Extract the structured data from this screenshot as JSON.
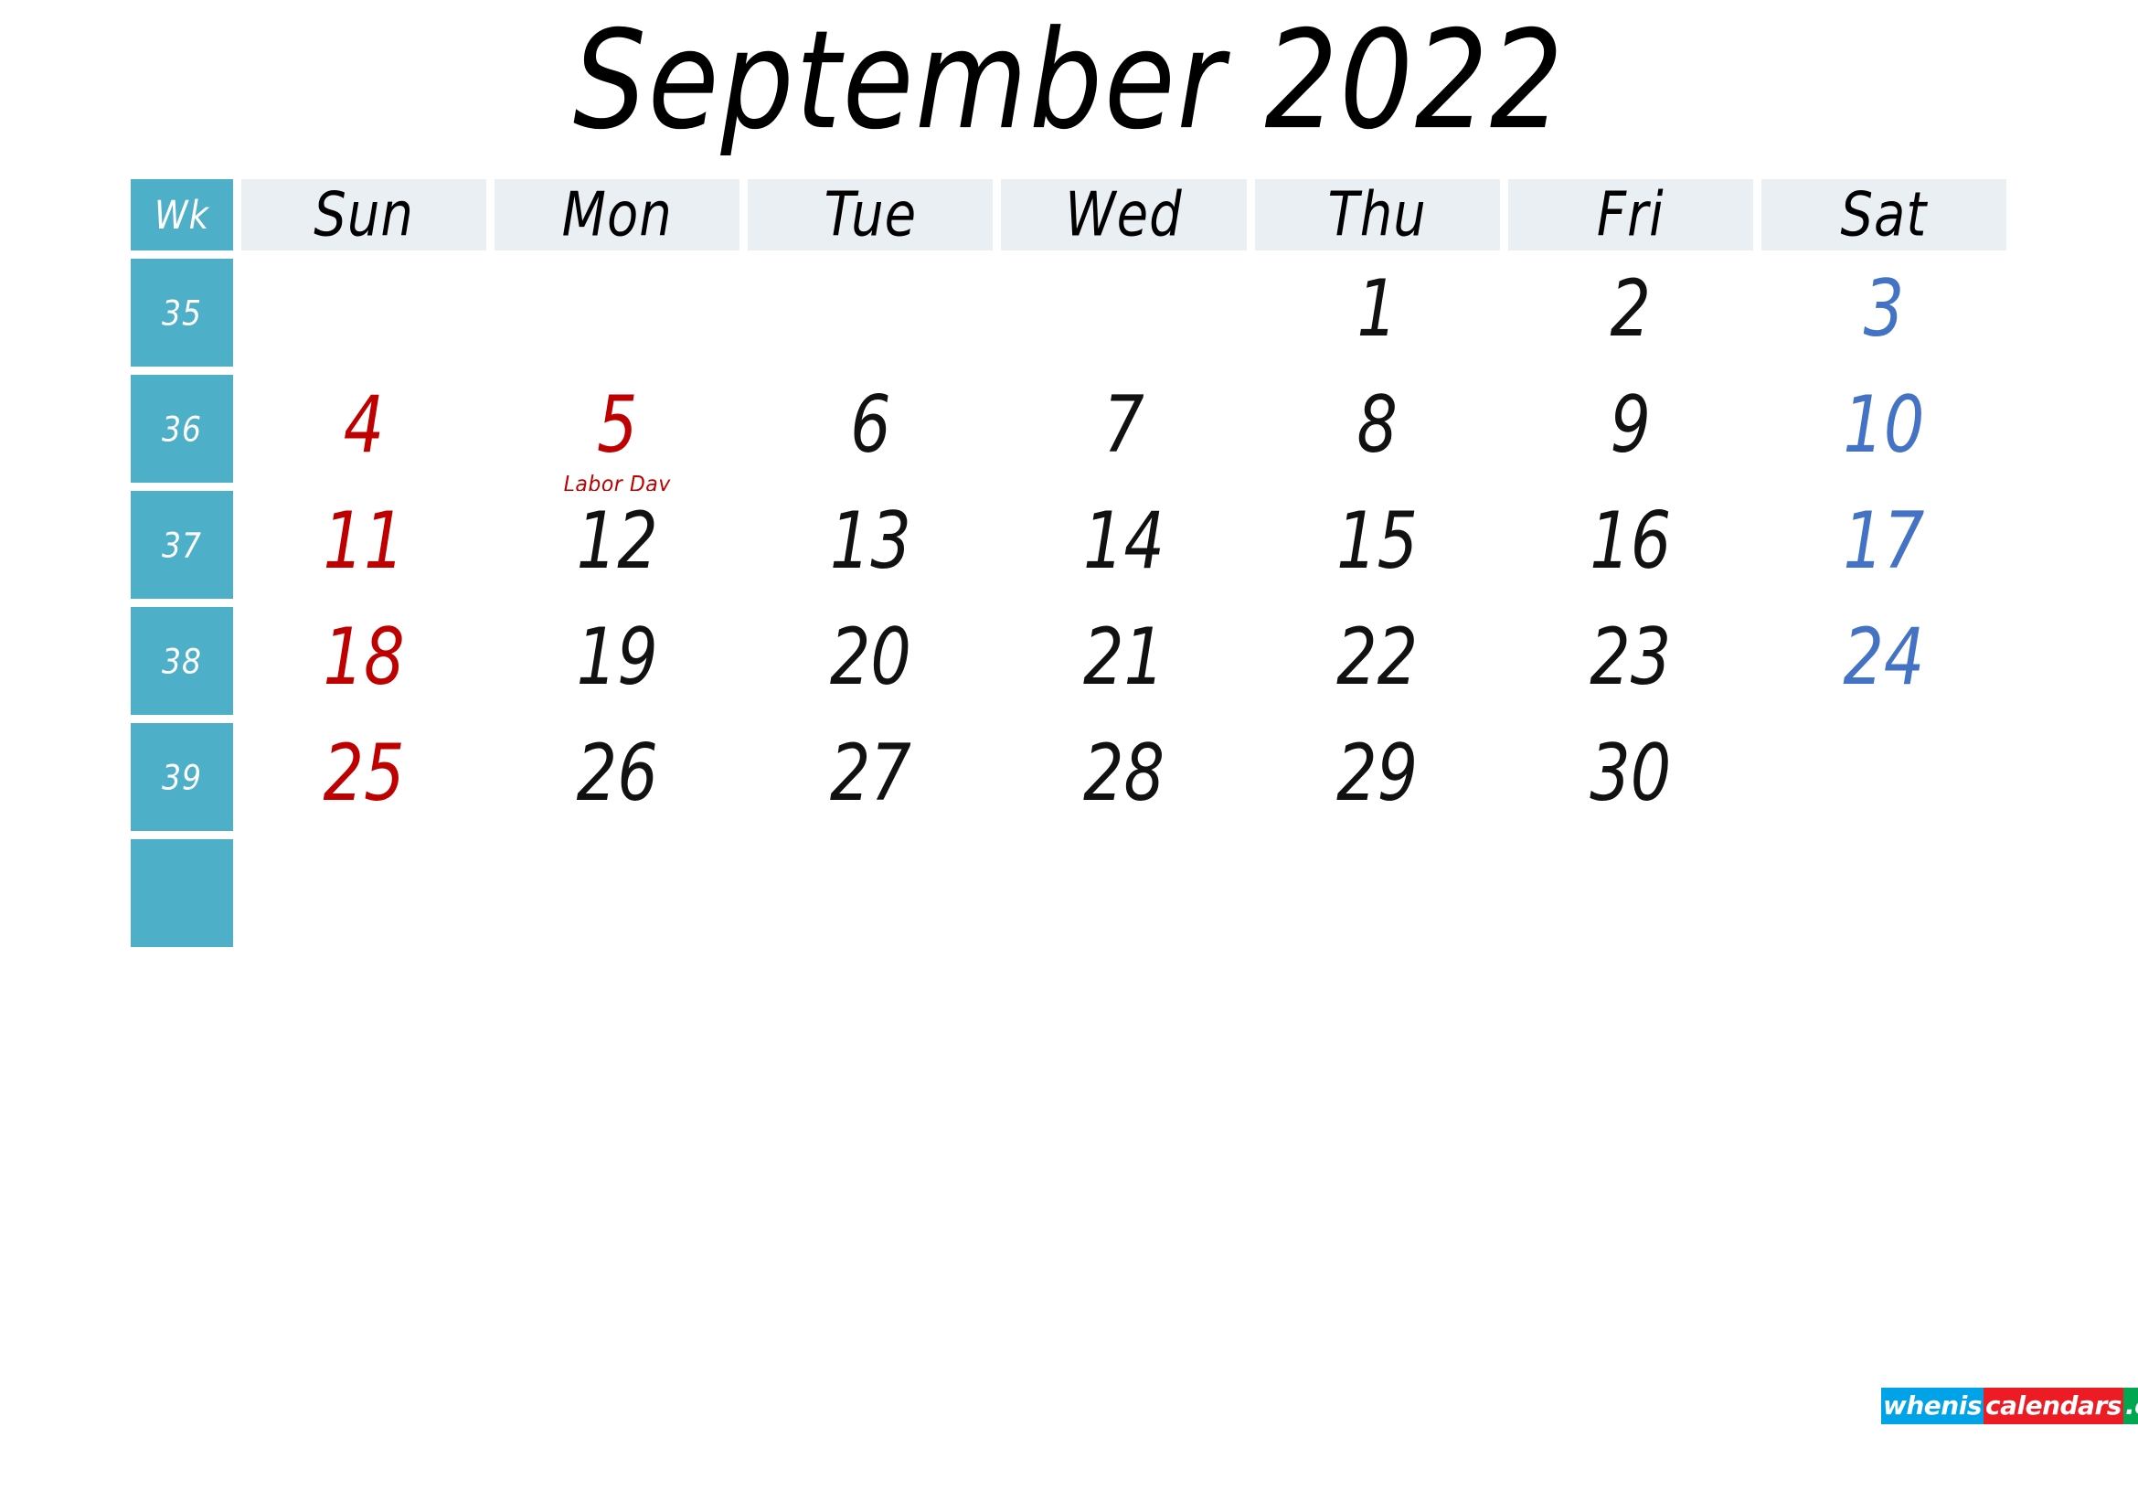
{
  "title": "September 2022",
  "colors": {
    "week_column_bg": "#4EAFC9",
    "day_header_bg": "#E9EFF2",
    "sunday_text": "#BE0000",
    "saturday_text": "#4472C4",
    "weekday_text": "#111111",
    "holiday_text": "#BE0000",
    "page_bg": "#FFFFFF"
  },
  "header": {
    "week_label": "Wk",
    "days": [
      "Sun",
      "Mon",
      "Tue",
      "Wed",
      "Thu",
      "Fri",
      "Sat"
    ]
  },
  "weeks": [
    {
      "week_number": "35",
      "days": [
        {
          "num": "",
          "kind": "sun"
        },
        {
          "num": "",
          "kind": "weekday"
        },
        {
          "num": "",
          "kind": "weekday"
        },
        {
          "num": "",
          "kind": "weekday"
        },
        {
          "num": "1",
          "kind": "weekday"
        },
        {
          "num": "2",
          "kind": "weekday"
        },
        {
          "num": "3",
          "kind": "sat"
        }
      ]
    },
    {
      "week_number": "36",
      "days": [
        {
          "num": "4",
          "kind": "sun"
        },
        {
          "num": "5",
          "kind": "sun",
          "holiday": "Labor Day"
        },
        {
          "num": "6",
          "kind": "weekday"
        },
        {
          "num": "7",
          "kind": "weekday"
        },
        {
          "num": "8",
          "kind": "weekday"
        },
        {
          "num": "9",
          "kind": "weekday"
        },
        {
          "num": "10",
          "kind": "sat"
        }
      ]
    },
    {
      "week_number": "37",
      "days": [
        {
          "num": "11",
          "kind": "sun"
        },
        {
          "num": "12",
          "kind": "weekday"
        },
        {
          "num": "13",
          "kind": "weekday"
        },
        {
          "num": "14",
          "kind": "weekday"
        },
        {
          "num": "15",
          "kind": "weekday"
        },
        {
          "num": "16",
          "kind": "weekday"
        },
        {
          "num": "17",
          "kind": "sat"
        }
      ]
    },
    {
      "week_number": "38",
      "days": [
        {
          "num": "18",
          "kind": "sun"
        },
        {
          "num": "19",
          "kind": "weekday"
        },
        {
          "num": "20",
          "kind": "weekday"
        },
        {
          "num": "21",
          "kind": "weekday"
        },
        {
          "num": "22",
          "kind": "weekday"
        },
        {
          "num": "23",
          "kind": "weekday"
        },
        {
          "num": "24",
          "kind": "sat"
        }
      ]
    },
    {
      "week_number": "39",
      "days": [
        {
          "num": "25",
          "kind": "sun"
        },
        {
          "num": "26",
          "kind": "weekday"
        },
        {
          "num": "27",
          "kind": "weekday"
        },
        {
          "num": "28",
          "kind": "weekday"
        },
        {
          "num": "29",
          "kind": "weekday"
        },
        {
          "num": "30",
          "kind": "weekday"
        },
        {
          "num": "",
          "kind": "sat"
        }
      ]
    },
    {
      "week_number": "",
      "days": [
        {
          "num": "",
          "kind": "sun"
        },
        {
          "num": "",
          "kind": "weekday"
        },
        {
          "num": "",
          "kind": "weekday"
        },
        {
          "num": "",
          "kind": "weekday"
        },
        {
          "num": "",
          "kind": "weekday"
        },
        {
          "num": "",
          "kind": "weekday"
        },
        {
          "num": "",
          "kind": "sat"
        }
      ]
    }
  ],
  "footer": {
    "logo_segments": [
      {
        "text": "whenis",
        "color": "#00A3E8"
      },
      {
        "text": "calendars",
        "color": "#ED1B24"
      },
      {
        "text": ".com",
        "color": "#00A650"
      }
    ]
  }
}
